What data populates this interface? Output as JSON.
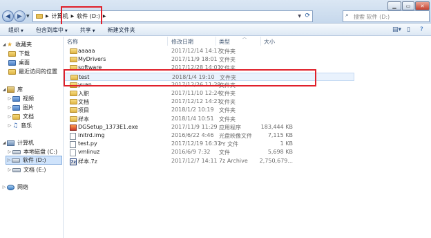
{
  "address": {
    "crumbs": [
      "计算机",
      "软件 (D:)"
    ]
  },
  "search": {
    "placeholder": "搜索 软件 (D:)"
  },
  "toolbar": {
    "organize": "组织",
    "include_in_library": "包含到库中",
    "share": "共享",
    "new_folder": "新建文件夹"
  },
  "nav": {
    "favorites": "收藏夹",
    "downloads": "下载",
    "desktop": "桌面",
    "recent": "最近访问的位置",
    "libraries": "库",
    "videos": "视频",
    "pictures": "图片",
    "documents": "文档",
    "music": "音乐",
    "computer": "计算机",
    "local_disk": "本地磁盘 (C:)",
    "software": "软件 (D:)",
    "docs_drive": "文档 (E:)",
    "network": "网络"
  },
  "columns": {
    "name": "名称",
    "date": "修改日期",
    "type": "类型",
    "size": "大小"
  },
  "files": [
    {
      "name": "aaaaa",
      "date": "2017/12/14 14:17",
      "type": "文件夹",
      "size": "",
      "icon": "folder"
    },
    {
      "name": "MyDrivers",
      "date": "2017/11/9 18:01",
      "type": "文件夹",
      "size": "",
      "icon": "folder"
    },
    {
      "name": "software",
      "date": "2017/12/28 14:01",
      "type": "文件夹",
      "size": "",
      "icon": "folder"
    },
    {
      "name": "test",
      "date": "2018/1/4 19:10",
      "type": "文件夹",
      "size": "",
      "icon": "folder"
    },
    {
      "name": "yuan",
      "date": "2017/12/26 11:29",
      "type": "文件夹",
      "size": "",
      "icon": "folder"
    },
    {
      "name": "入职",
      "date": "2017/11/10 12:24",
      "type": "文件夹",
      "size": "",
      "icon": "folder"
    },
    {
      "name": "文档",
      "date": "2017/12/12 14:21",
      "type": "文件夹",
      "size": "",
      "icon": "folder"
    },
    {
      "name": "项目",
      "date": "2018/1/2 10:19",
      "type": "文件夹",
      "size": "",
      "icon": "folder"
    },
    {
      "name": "样本",
      "date": "2018/1/4 10:51",
      "type": "文件夹",
      "size": "",
      "icon": "folder"
    },
    {
      "name": "DGSetup_1373E1.exe",
      "date": "2017/11/9 11:29",
      "type": "应用程序",
      "size": "183,444 KB",
      "icon": "exe"
    },
    {
      "name": "initrd.img",
      "date": "2016/6/22 4:46",
      "type": "光盘映像文件",
      "size": "7,115 KB",
      "icon": "img"
    },
    {
      "name": "test.py",
      "date": "2017/12/19 16:37",
      "type": "PY 文件",
      "size": "1 KB",
      "icon": "py"
    },
    {
      "name": "vmlinuz",
      "date": "2016/6/9 7:32",
      "type": "文件",
      "size": "5,698 KB",
      "icon": "file"
    },
    {
      "name": "样本.7z",
      "date": "2017/12/7 14:11",
      "type": "7z Archive",
      "size": "2,750,679...",
      "icon": "7z"
    }
  ],
  "annotation_color": "#e0202a"
}
